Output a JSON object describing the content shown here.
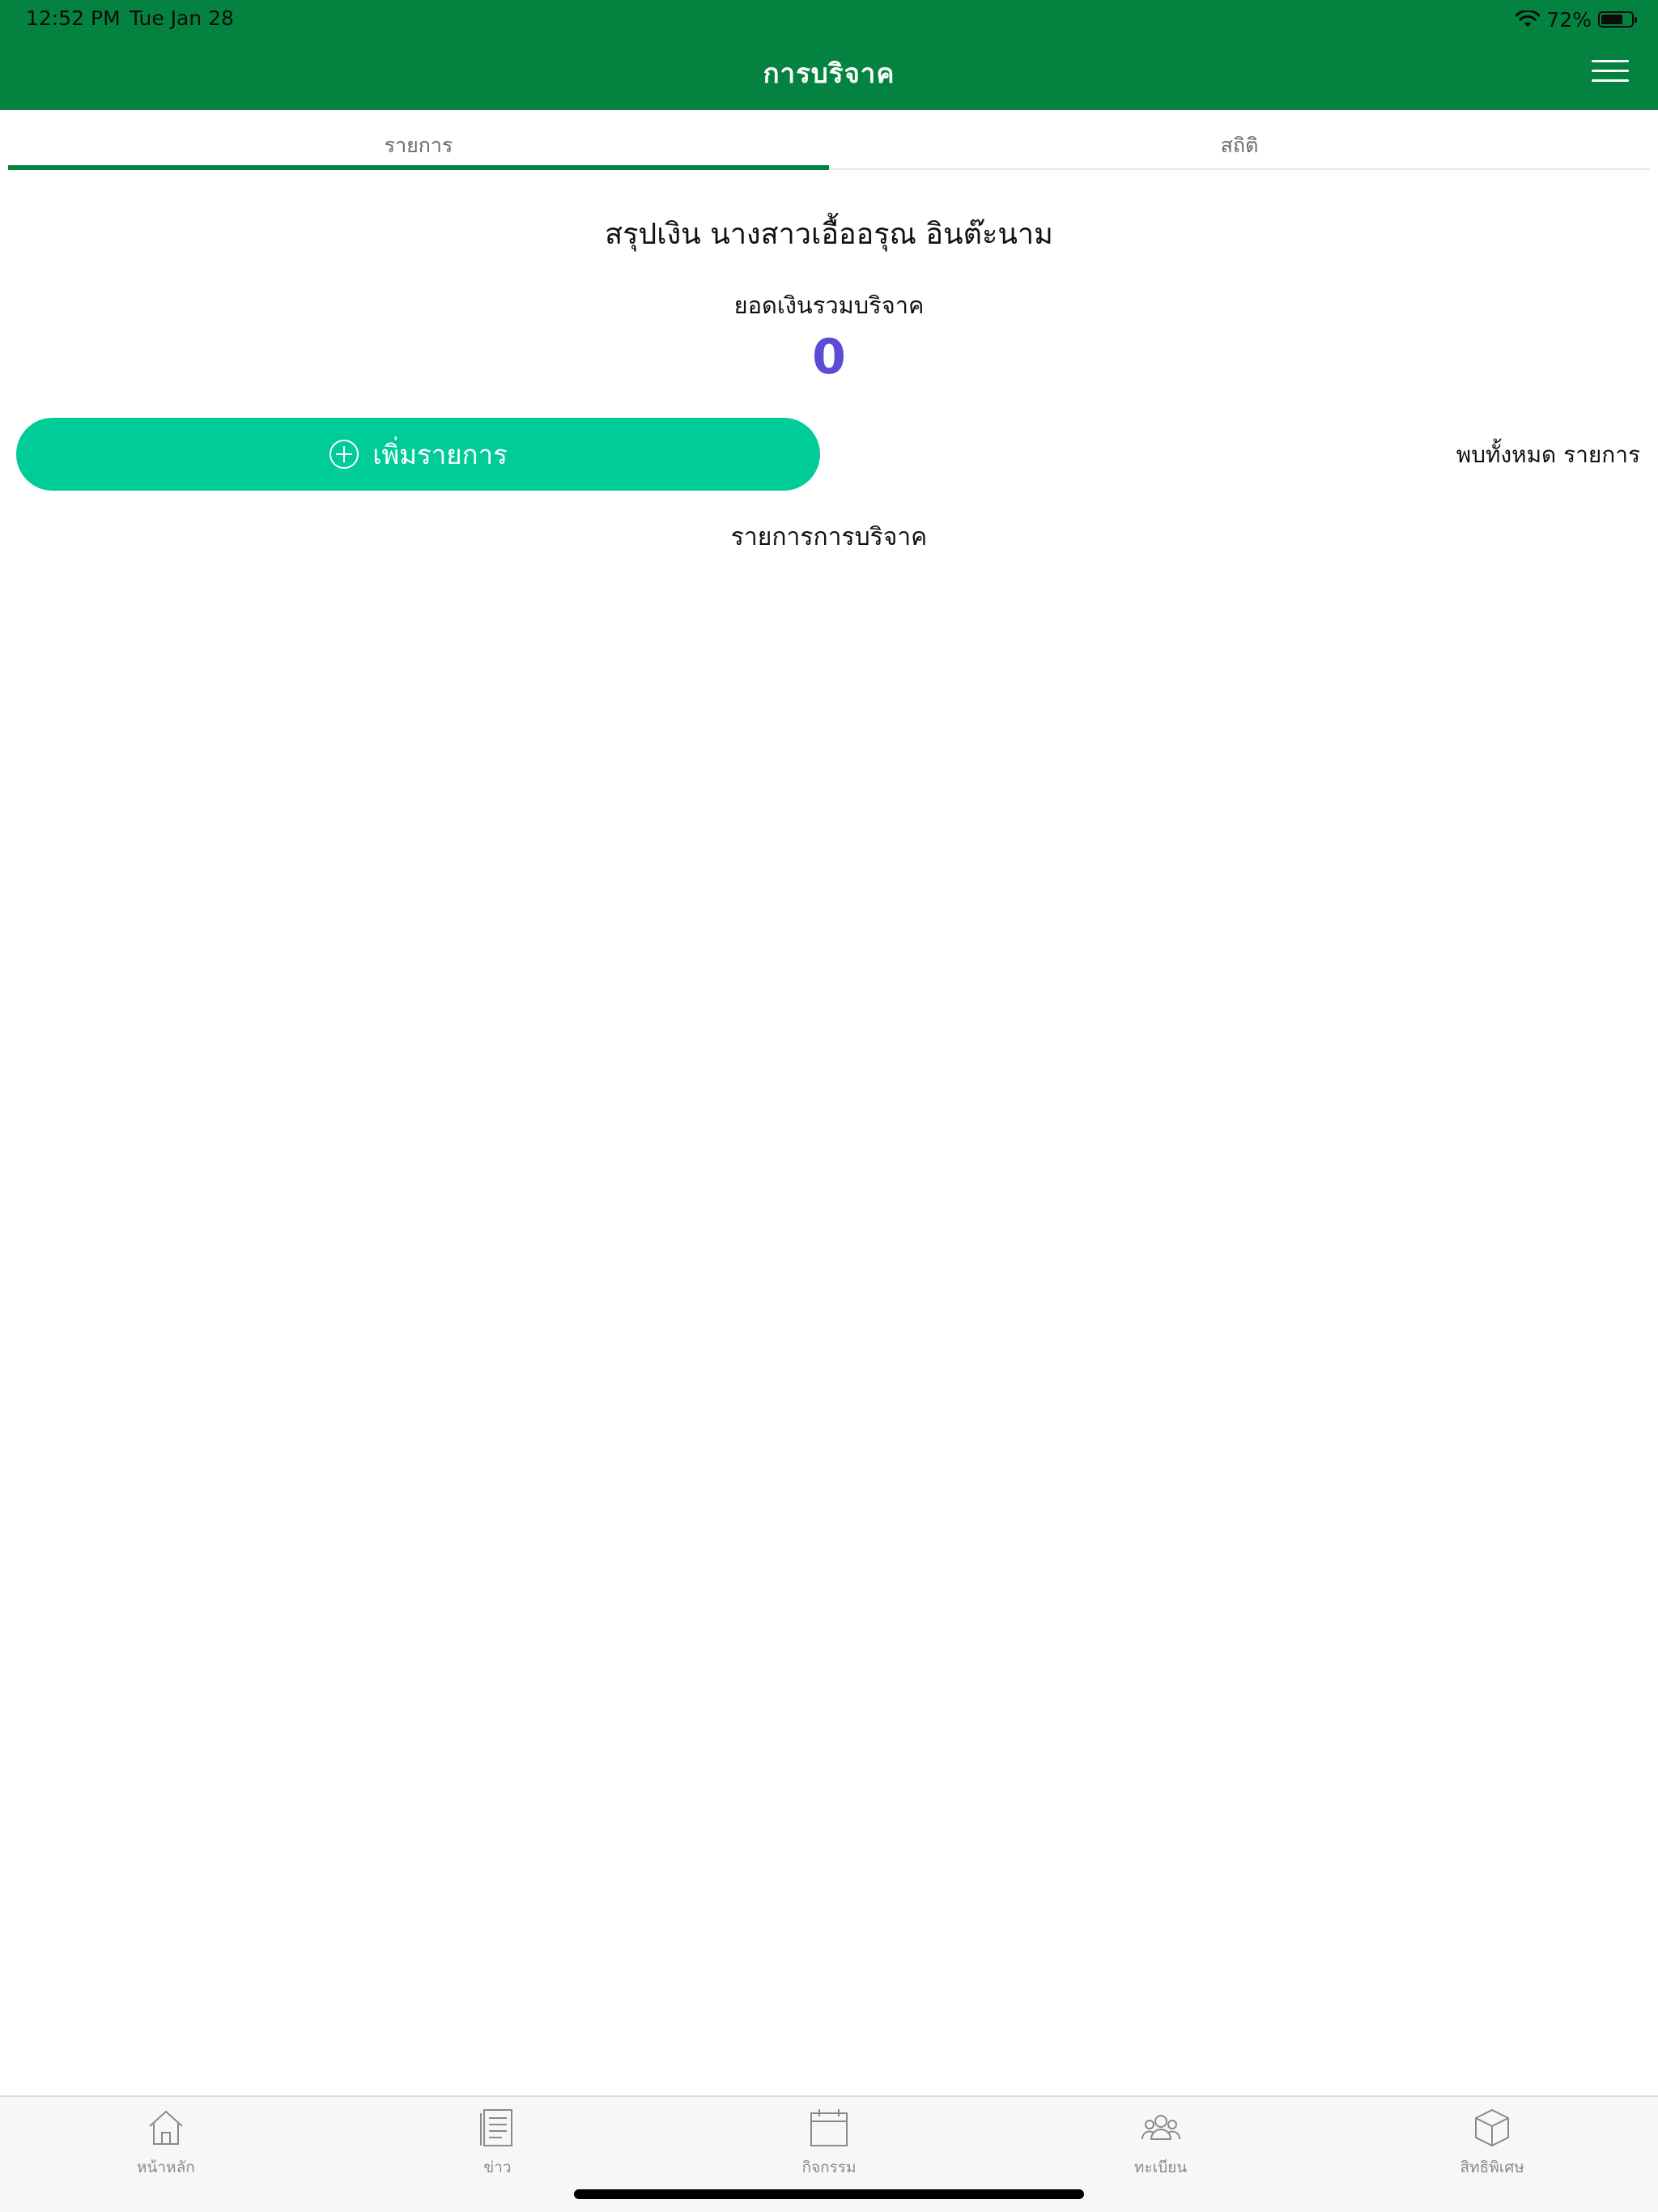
{
  "status_bar": {
    "time": "12:52 PM",
    "date": "Tue Jan 28",
    "battery": "72%",
    "battery_level": 0.72
  },
  "header": {
    "title": "การบริจาค"
  },
  "tabs": [
    {
      "label": "รายการ",
      "active": true
    },
    {
      "label": "สถิติ",
      "active": false
    }
  ],
  "summary": {
    "title": "สรุปเงิน นางสาวเอื้ออรุณ อินต๊ะนาม",
    "total_label": "ยอดเงินรวมบริจาค",
    "total_value": "0"
  },
  "actions": {
    "add_label": "เพิ่มรายการ",
    "found_text": "พบทั้งหมด  รายการ"
  },
  "list": {
    "title": "รายการการบริจาค"
  },
  "bottom_nav": [
    {
      "label": "หน้าหลัก",
      "icon": "home-icon"
    },
    {
      "label": "ข่าว",
      "icon": "news-icon"
    },
    {
      "label": "กิจกรรม",
      "icon": "calendar-icon"
    },
    {
      "label": "ทะเบียน",
      "icon": "people-icon"
    },
    {
      "label": "สิทธิพิเศษ",
      "icon": "box-icon"
    }
  ],
  "colors": {
    "header_green": "#048340",
    "button_teal": "#00cc99",
    "value_purple": "#5b4bd6"
  }
}
